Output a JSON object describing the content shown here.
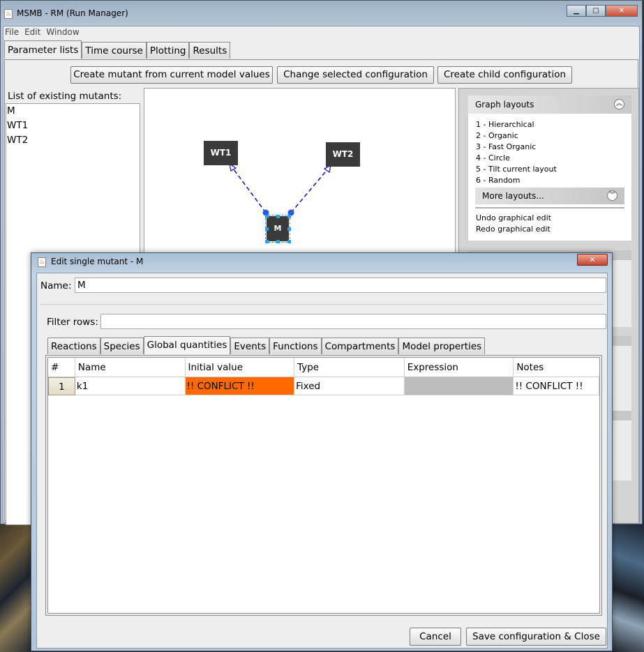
{
  "window": {
    "title": "MSMB - RM (Run Manager)",
    "controls": {
      "minimize": "▁",
      "maximize": "□",
      "close": "✕"
    }
  },
  "menu": [
    "File",
    "Edit",
    "Window"
  ],
  "main_tabs": [
    "Parameter lists",
    "Time course",
    "Plotting",
    "Results"
  ],
  "toolbar": {
    "create_mutant": "Create mutant from current model values",
    "change_config": "Change selected configuration",
    "create_child": "Create child configuration"
  },
  "mutants": {
    "label": "List of existing mutants:",
    "items": [
      "M",
      "WT1",
      "WT2"
    ]
  },
  "graph": {
    "nodes": {
      "wt1": "WT1",
      "wt2": "WT2",
      "m": "M"
    },
    "edge_color": "#1a1acc",
    "selection_color": "#3a9ae0"
  },
  "side_panel": {
    "title": "Graph layouts",
    "layouts": [
      "1 - Hierarchical",
      "2 - Organic",
      "3 - Fast Organic",
      "4 - Circle",
      "5 - Tilt current layout",
      "6 - Random"
    ],
    "more_layouts": "More layouts...",
    "undo": "Undo graphical edit",
    "redo": "Redo graphical edit"
  },
  "dialog": {
    "title": "Edit single mutant - M",
    "close": "✕",
    "name_label": "Name:",
    "name_value": "M",
    "filter_label": "Filter rows:",
    "filter_value": "",
    "tabs": [
      "Reactions",
      "Species",
      "Global quantities",
      "Events",
      "Functions",
      "Compartments",
      "Model properties"
    ],
    "active_tab": "Global quantities",
    "table": {
      "headers": [
        "#",
        "Name",
        "Initial value",
        "Type",
        "Expression",
        "Notes"
      ],
      "rows": [
        {
          "num": "1",
          "name": "k1",
          "initial_value": "!! CONFLICT !!",
          "type": "Fixed",
          "expression": "",
          "notes": "!! CONFLICT !!"
        }
      ],
      "conflict_color": "#ff6a00",
      "expression_disabled_color": "#bdbdbd"
    },
    "cancel": "Cancel",
    "save": "Save configuration & Close"
  }
}
